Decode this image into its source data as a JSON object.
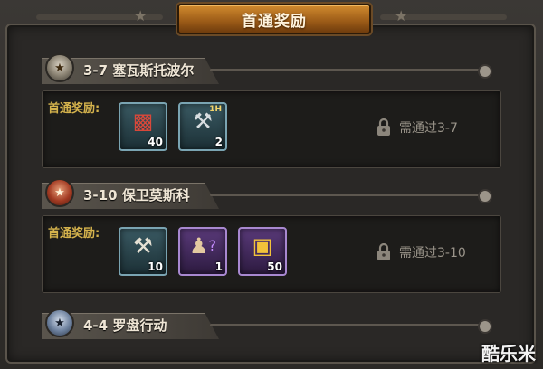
{
  "title": "首通奖励",
  "stages": [
    {
      "name": "3-7 塞瓦斯托波尔",
      "reward_label": "首通奖励:",
      "items": [
        {
          "icon": "book-icon",
          "count": "40"
        },
        {
          "icon": "pickaxe-icon",
          "count": "2",
          "tag": "1H"
        }
      ],
      "requirement": "需通过3-7"
    },
    {
      "name": "3-10 保卫莫斯科",
      "reward_label": "首通奖励:",
      "items": [
        {
          "icon": "blueprint-hammer-icon",
          "count": "10"
        },
        {
          "icon": "officer-mystery-icon",
          "count": "1"
        },
        {
          "icon": "gold-bars-icon",
          "count": "50"
        }
      ],
      "requirement": "需通过3-10"
    },
    {
      "name": "4-4 罗盘行动"
    }
  ],
  "watermark": "酷乐米"
}
